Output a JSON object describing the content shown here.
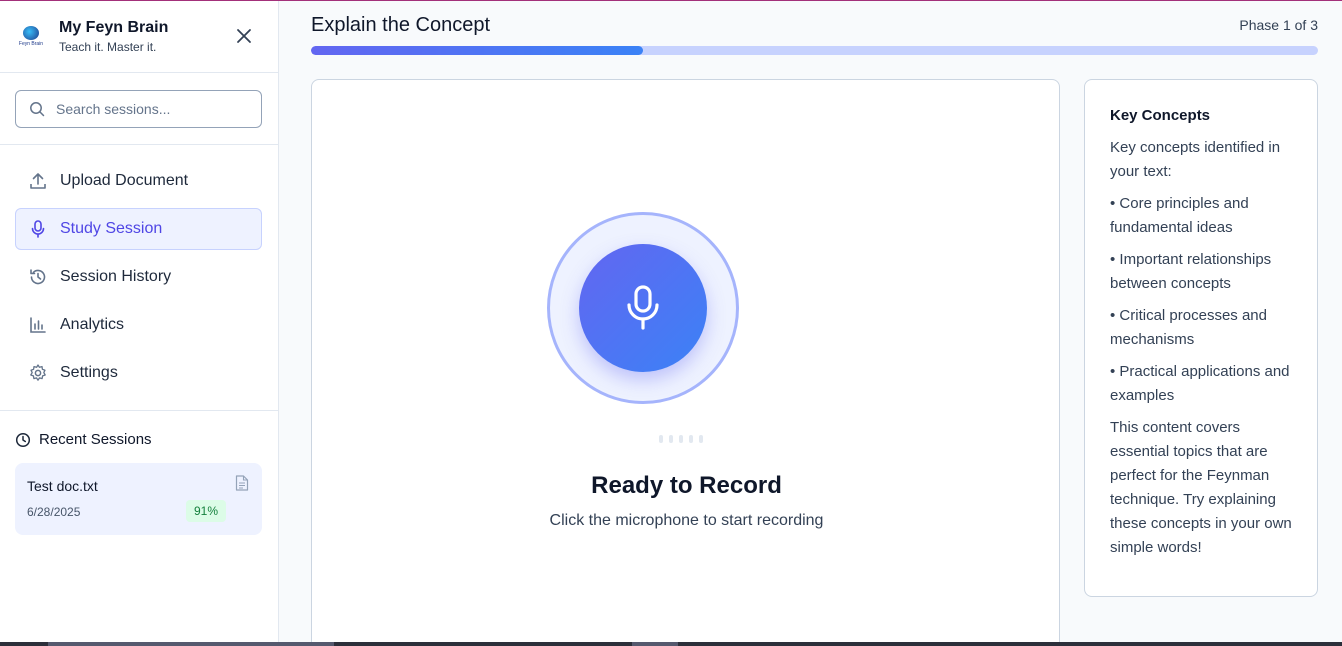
{
  "brand": {
    "title": "My Feyn Brain",
    "subtitle": "Teach it. Master it.",
    "logo_text": "Feyn Brain"
  },
  "search": {
    "placeholder": "Search sessions..."
  },
  "nav": {
    "items": [
      {
        "label": "Upload Document",
        "icon": "upload-icon"
      },
      {
        "label": "Study Session",
        "icon": "microphone-icon",
        "active": true
      },
      {
        "label": "Session History",
        "icon": "history-icon"
      },
      {
        "label": "Analytics",
        "icon": "bar-chart-icon"
      },
      {
        "label": "Settings",
        "icon": "gear-icon"
      }
    ]
  },
  "recent": {
    "title": "Recent Sessions",
    "sessions": [
      {
        "name": "Test doc.txt",
        "date": "6/28/2025",
        "score": "91%"
      }
    ]
  },
  "main": {
    "phase_title": "Explain the Concept",
    "phase_label": "Phase 1 of 3",
    "progress": 0.33,
    "ready_title": "Ready to Record",
    "ready_subtitle": "Click the microphone to start recording"
  },
  "concepts": {
    "title": "Key Concepts",
    "intro": "Key concepts identified in your text:",
    "items": [
      "• Core principles and fundamental ideas",
      "• Important relationships between concepts",
      "• Critical processes and mechanisms",
      "• Practical applications and examples"
    ],
    "outro": "This content covers essential topics that are perfect for the Feynman technique. Try explaining these concepts in your own simple words!"
  },
  "colors": {
    "accent": "#4f46e5",
    "accent_light": "#eef2ff",
    "progress_gradient_start": "#6366f1",
    "progress_gradient_end": "#3b82f6",
    "score_bg": "#dcfce7",
    "score_text": "#15803d"
  }
}
